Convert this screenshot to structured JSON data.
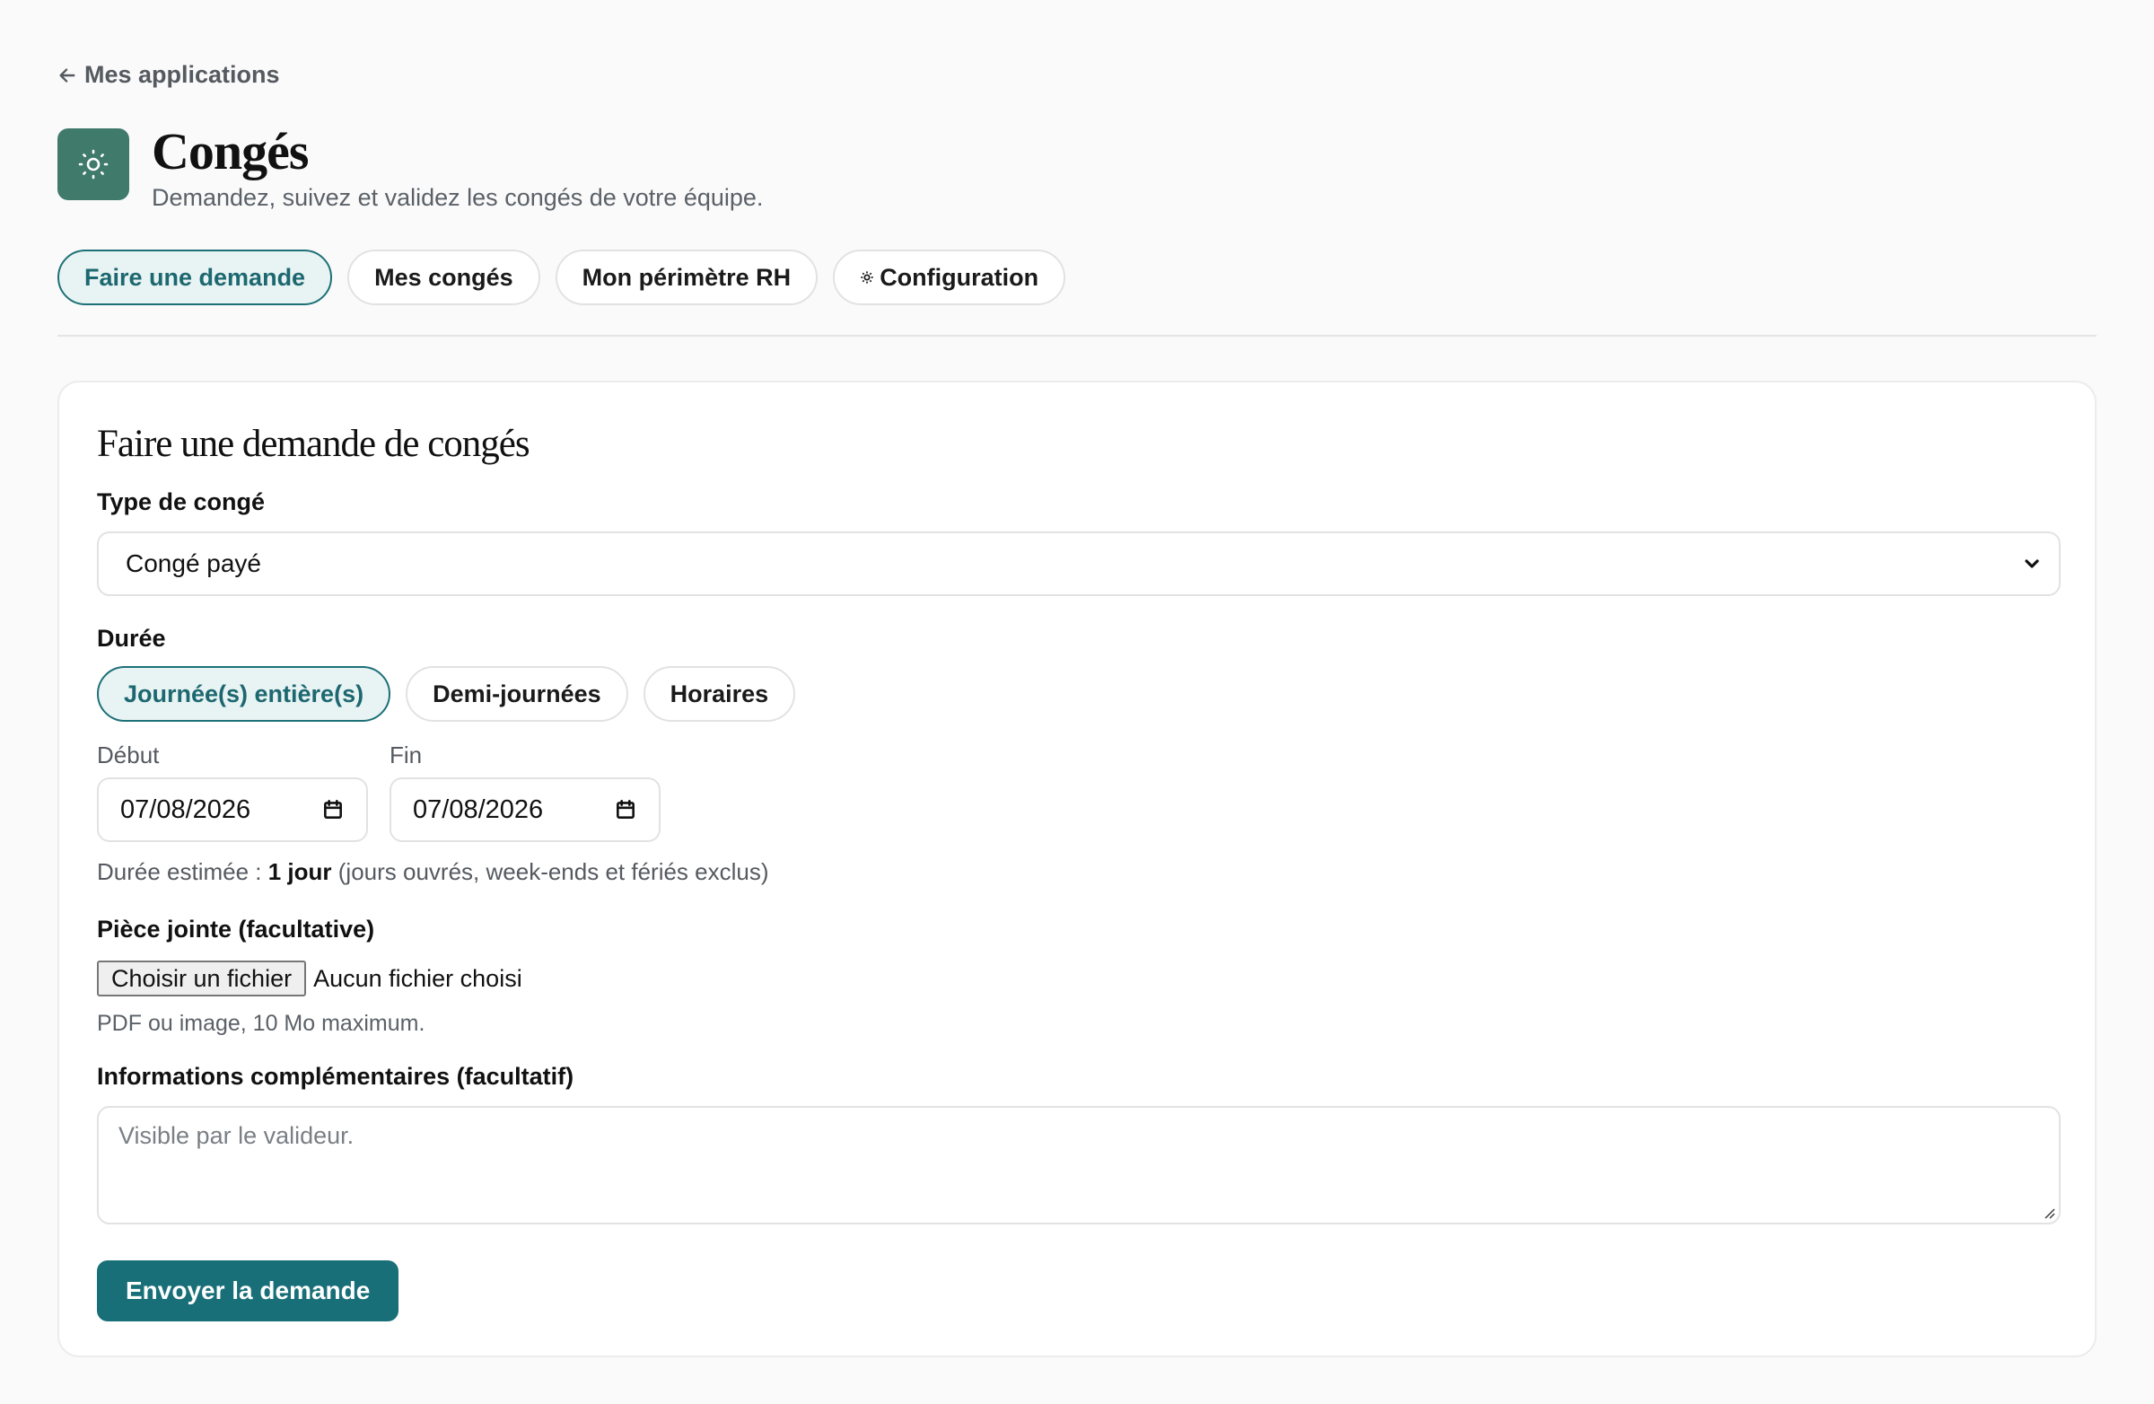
{
  "nav": {
    "back_label": "Mes applications"
  },
  "app": {
    "title": "Congés",
    "subtitle": "Demandez, suivez et validez les congés de votre équipe.",
    "icon": "sun-icon",
    "icon_color": "#3f7a6b"
  },
  "tabs": [
    {
      "label": "Faire une demande",
      "active": true
    },
    {
      "label": "Mes congés",
      "active": false
    },
    {
      "label": "Mon périmètre RH",
      "active": false
    },
    {
      "label": "Configuration",
      "active": false,
      "icon": "gear-icon"
    }
  ],
  "form": {
    "title": "Faire une demande de congés",
    "type_label": "Type de congé",
    "type_value": "Congé payé",
    "duration_label": "Durée",
    "duration_options": [
      {
        "label": "Journée(s) entière(s)",
        "active": true
      },
      {
        "label": "Demi-journées",
        "active": false
      },
      {
        "label": "Horaires",
        "active": false
      }
    ],
    "start_label": "Début",
    "start_value": "07/08/2026",
    "end_label": "Fin",
    "end_value": "07/08/2026",
    "estimate_prefix": "Durée estimée : ",
    "estimate_value": "1 jour",
    "estimate_suffix": " (jours ouvrés, week-ends et fériés exclus)",
    "attachment_label": "Pièce jointe (facultative)",
    "file_button": "Choisir un fichier",
    "file_status": "Aucun fichier choisi",
    "attachment_hint": "PDF ou image, 10 Mo maximum.",
    "info_label": "Informations complémentaires (facultatif)",
    "info_placeholder": "Visible par le valideur.",
    "submit_label": "Envoyer la demande"
  },
  "colors": {
    "accent": "#1d7077",
    "active_bg": "#e8f3f3",
    "submit_bg": "#196f78"
  }
}
